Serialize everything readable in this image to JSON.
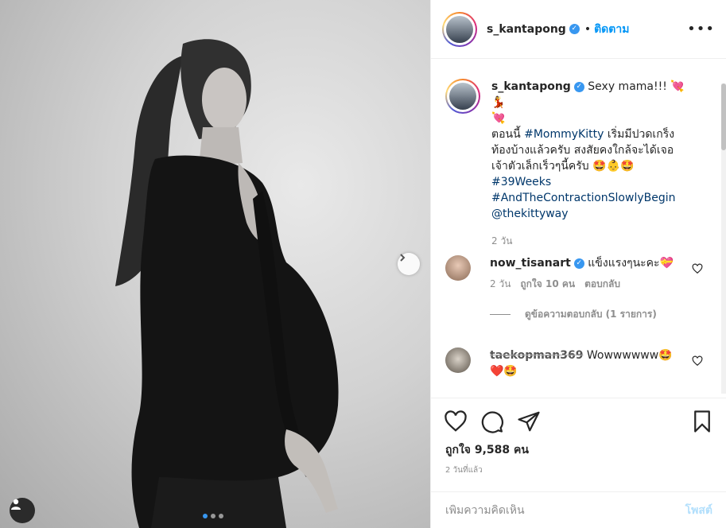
{
  "post": {
    "slide_count": 3,
    "active_slide": 1
  },
  "header": {
    "username": "s_kantapong",
    "verified": true,
    "separator": "•",
    "follow_label": "ติดตาม",
    "more_label": "•••"
  },
  "caption": {
    "username": "s_kantapong",
    "text_line1": "Sexy mama!!! 💘💃",
    "text_line2": "💘",
    "text_line3_pre": "ตอนนี้ ",
    "hashtag_mommy": "#MommyKitty",
    "text_line3_post": " เริ่มมีปวดเกร็ง",
    "text_line4": "ท้องบ้างแล้วครับ สงสัยคงใกล้จะได้เจอ",
    "text_line5": "เจ้าตัวเล็กเร็วๆนี้ครับ 🤩👶🤩",
    "hashtag_weeks": "#39Weeks",
    "hashtag_contraction": "#AndTheContractionSlowlyBegin",
    "mention": "@thekittyway",
    "time": "2 วัน"
  },
  "comments": [
    {
      "username": "now_tisanart",
      "text": "แข็งแรงๆนะคะ💝",
      "time": "2 วัน",
      "likes": "ถูกใจ 10 คน",
      "reply_label": "ตอบกลับ",
      "view_replies": "ดูข้อความตอบกลับ (1 รายการ)"
    },
    {
      "username": "taekopman369",
      "text": "Wowwwwww🤩",
      "text_line2": "❤️🤩"
    }
  ],
  "actions": {
    "likes": "ถูกใจ 9,588 คน",
    "posted_time": "2 วันที่แล้ว"
  },
  "add_comment": {
    "placeholder": "เพิ่มความคิดเห็น",
    "post_label": "โพสต์"
  }
}
